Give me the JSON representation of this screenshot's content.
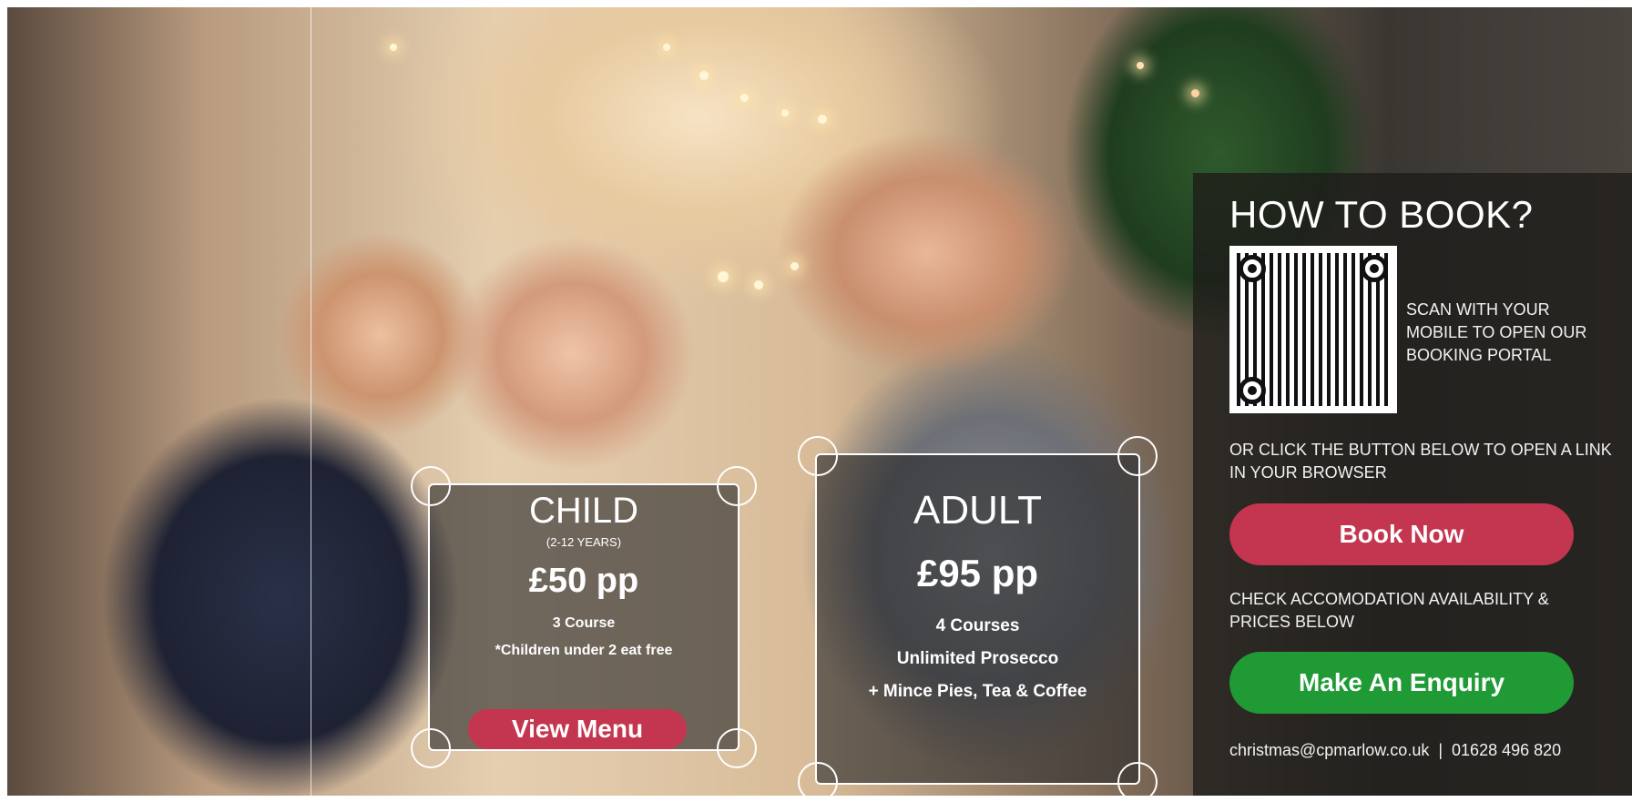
{
  "booking": {
    "title": "HOW TO BOOK?",
    "scan_text": "SCAN WITH YOUR MOBILE TO OPEN OUR BOOKING PORTAL",
    "or_text": "OR CLICK THE BUTTON BELOW TO OPEN A LINK IN YOUR BROWSER",
    "book_label": "Book Now",
    "check_text": "CHECK ACCOMODATION AVAILABILITY & PRICES BELOW",
    "enquiry_label": "Make An Enquiry",
    "email": "christmas@cpmarlow.co.uk",
    "separator": "|",
    "phone": "01628 496 820"
  },
  "child": {
    "title": "CHILD",
    "age": "(2-12 YEARS)",
    "price": "£50 pp",
    "line1": "3 Course",
    "line2": "*Children under 2 eat free",
    "menu_label": "View Menu"
  },
  "adult": {
    "title": "ADULT",
    "price": "£95 pp",
    "line1": "4 Courses",
    "line2": "Unlimited Prosecco",
    "line3": "+ Mince Pies, Tea & Coffee"
  },
  "colors": {
    "book_button": "#c4364f",
    "enquiry_button": "#1f9a35",
    "panel": "#1e1c1a"
  }
}
